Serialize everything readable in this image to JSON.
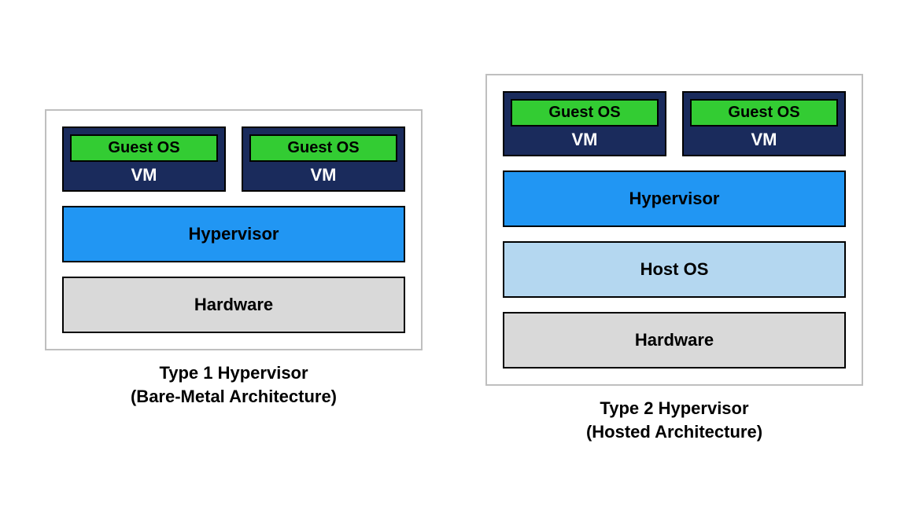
{
  "type1": {
    "caption_line1": "Type 1 Hypervisor",
    "caption_line2": "(Bare-Metal Architecture)",
    "layers": {
      "hardware": "Hardware",
      "hypervisor": "Hypervisor"
    },
    "vms": [
      {
        "guest_os": "Guest OS",
        "vm_label": "VM"
      },
      {
        "guest_os": "Guest OS",
        "vm_label": "VM"
      }
    ]
  },
  "type2": {
    "caption_line1": "Type 2 Hypervisor",
    "caption_line2": "(Hosted Architecture)",
    "layers": {
      "hardware": "Hardware",
      "host_os": "Host OS",
      "hypervisor": "Hypervisor"
    },
    "vms": [
      {
        "guest_os": "Guest OS",
        "vm_label": "VM"
      },
      {
        "guest_os": "Guest OS",
        "vm_label": "VM"
      }
    ]
  }
}
